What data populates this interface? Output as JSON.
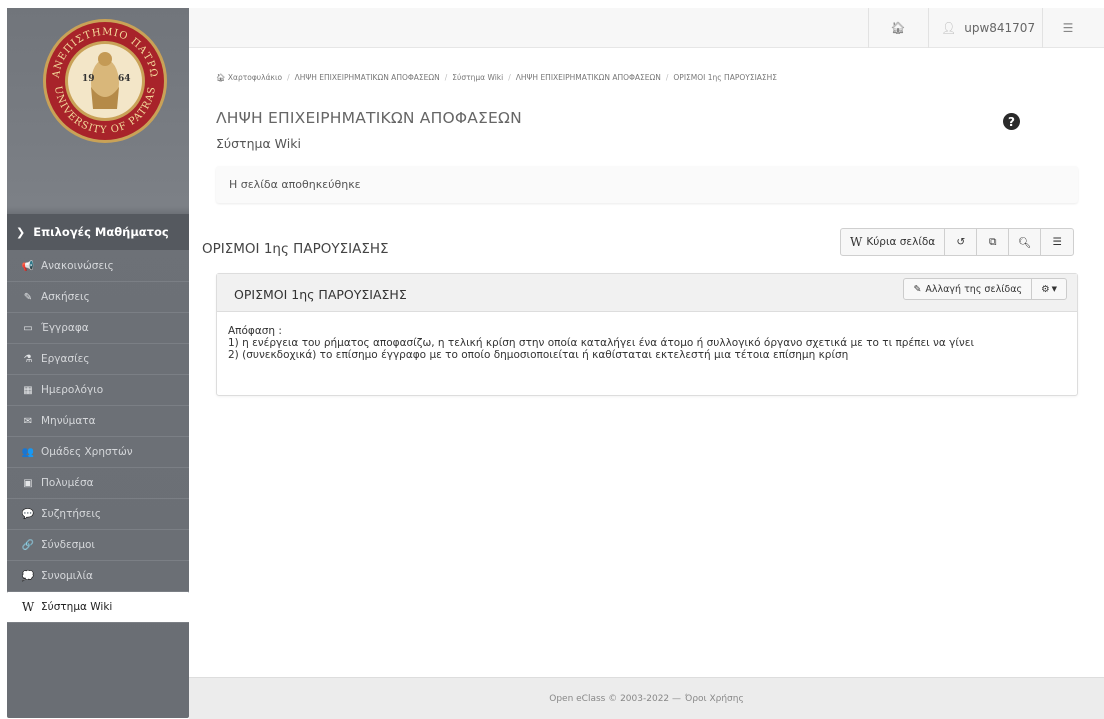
{
  "sidebar": {
    "logo": {
      "ring_text_top": "ΠΑΝΕΠΙΣΤΗΜΙΟ ΠΑΤΡΩΝ",
      "ring_text_bottom": "UNIVERSITY OF PATRAS",
      "year_left": "19",
      "year_right": "64",
      "colors": {
        "ring": "#a8232a",
        "gold": "#c9a257",
        "inner": "#f3e6c8"
      }
    },
    "course_menu_label": "Επιλογές Μαθήματος",
    "items": [
      {
        "icon": "megaphone-icon",
        "glyph": "📢",
        "label": "Ανακοινώσεις",
        "active": false
      },
      {
        "icon": "edit-icon",
        "glyph": "✎",
        "label": "Ασκήσεις",
        "active": false
      },
      {
        "icon": "folder-icon",
        "glyph": "▭",
        "label": "Έγγραφα",
        "active": false
      },
      {
        "icon": "flask-icon",
        "glyph": "⚗",
        "label": "Εργασίες",
        "active": false
      },
      {
        "icon": "calendar-icon",
        "glyph": "▦",
        "label": "Ημερολόγιο",
        "active": false
      },
      {
        "icon": "envelope-icon",
        "glyph": "✉",
        "label": "Μηνύματα",
        "active": false
      },
      {
        "icon": "users-icon",
        "glyph": "👥",
        "label": "Ομάδες Χρηστών",
        "active": false
      },
      {
        "icon": "film-icon",
        "glyph": "▣",
        "label": "Πολυμέσα",
        "active": false
      },
      {
        "icon": "comments-icon",
        "glyph": "💬",
        "label": "Συζητήσεις",
        "active": false
      },
      {
        "icon": "link-icon",
        "glyph": "🔗",
        "label": "Σύνδεσμοι",
        "active": false
      },
      {
        "icon": "chat-icon",
        "glyph": "💭",
        "label": "Συνομιλία",
        "active": false
      },
      {
        "icon": "wikipedia-icon",
        "glyph": "W",
        "label": "Σύστημα Wiki",
        "active": true
      }
    ]
  },
  "topbar": {
    "home_icon": "home-icon",
    "username": "upw841707",
    "user_icon": "user-icon",
    "settings_icon": "sliders-icon"
  },
  "breadcrumb": [
    "Χαρτοφυλάκιο",
    "ΛΗΨΗ ΕΠΙΧΕΙΡΗΜΑΤΙΚΩΝ ΑΠΟΦΑΣΕΩΝ",
    "Σύστημα Wiki",
    "ΛΗΨΗ ΕΠΙΧΕΙΡΗΜΑΤΙΚΩΝ ΑΠΟΦΑΣΕΩΝ",
    "ΟΡΙΣΜΟΙ 1ης ΠΑΡΟΥΣΙΑΣΗΣ"
  ],
  "page": {
    "title": "ΛΗΨΗ ΕΠΙΧΕΙΡΗΜΑΤΙΚΩΝ ΑΠΟΦΑΣΕΩΝ",
    "subtitle": "Σύστημα Wiki",
    "alert": "Η σελίδα αποθηκεύθηκε",
    "section_title": "ΟΡΙΣΜΟΙ 1ης ΠΑΡΟΥΣΙΑΣΗΣ"
  },
  "wiki_toolbar": {
    "main_page_label": "Κύρια σελίδα",
    "history_icon": "history-icon",
    "recent_icon": "recent-changes-icon",
    "search_icon": "search-icon",
    "list_icon": "list-icon"
  },
  "panel": {
    "title": "ΟΡΙΣΜΟΙ 1ης ΠΑΡΟΥΣΙΑΣΗΣ",
    "edit_label": "Αλλαγή της σελίδας",
    "body_lines": [
      "Απόφαση :",
      "1) η ενέργεια του ρήματος αποφασίζω, η τελική κρίση στην οποία καταλήγει ένα άτομο ή συλλογικό όργανο σχετικά με το τι πρέπει να γίνει",
      "2) (συνεκδοχικά) το επίσημο έγγραφο με το οποίο δημοσιοποιείται ή καθίσταται εκτελεστή μια τέτοια επίσημη κρίση"
    ]
  },
  "footer": {
    "copyright": "Open eClass © 2003-2022 —",
    "terms": "Όροι Χρήσης"
  }
}
